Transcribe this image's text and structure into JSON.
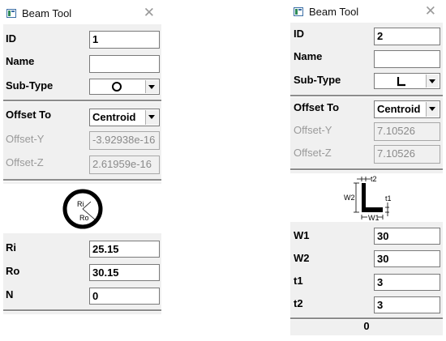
{
  "left_panel": {
    "title": "Beam Tool",
    "fields": {
      "id": {
        "label": "ID",
        "value": "1"
      },
      "name": {
        "label": "Name",
        "value": ""
      },
      "subtype": {
        "label": "Sub-Type",
        "icon": "circle-section-icon"
      },
      "offset_to": {
        "label": "Offset To",
        "value": "Centroid"
      },
      "offset_y": {
        "label": "Offset-Y",
        "value": "-3.92938e-16"
      },
      "offset_z": {
        "label": "Offset-Z",
        "value": "2.61959e-16"
      }
    },
    "diagram": {
      "icon": "ring-section-diagram",
      "inner_label": "Ri",
      "outer_label": "Ro"
    },
    "params": [
      {
        "label": "Ri",
        "value": "25.15"
      },
      {
        "label": "Ro",
        "value": "30.15"
      },
      {
        "label": "N",
        "value": "0"
      }
    ]
  },
  "right_panel": {
    "title": "Beam Tool",
    "fields": {
      "id": {
        "label": "ID",
        "value": "2"
      },
      "name": {
        "label": "Name",
        "value": ""
      },
      "subtype": {
        "label": "Sub-Type",
        "icon": "l-section-icon"
      },
      "offset_to": {
        "label": "Offset To",
        "value": "Centroid"
      },
      "offset_y": {
        "label": "Offset-Y",
        "value": "7.10526"
      },
      "offset_z": {
        "label": "Offset-Z",
        "value": "7.10526"
      }
    },
    "diagram": {
      "icon": "l-section-diagram",
      "t2": "t2",
      "w2": "W2",
      "t1": "t1",
      "w1": "W1"
    },
    "params": [
      {
        "label": "W1",
        "value": "30"
      },
      {
        "label": "W2",
        "value": "30"
      },
      {
        "label": "t1",
        "value": "3"
      },
      {
        "label": "t2",
        "value": "3"
      }
    ],
    "status": "0"
  },
  "colors": {
    "panel_bg": "#f0f0f0",
    "disabled_text": "#9a9a9a",
    "separator": "#8c8c8c"
  }
}
